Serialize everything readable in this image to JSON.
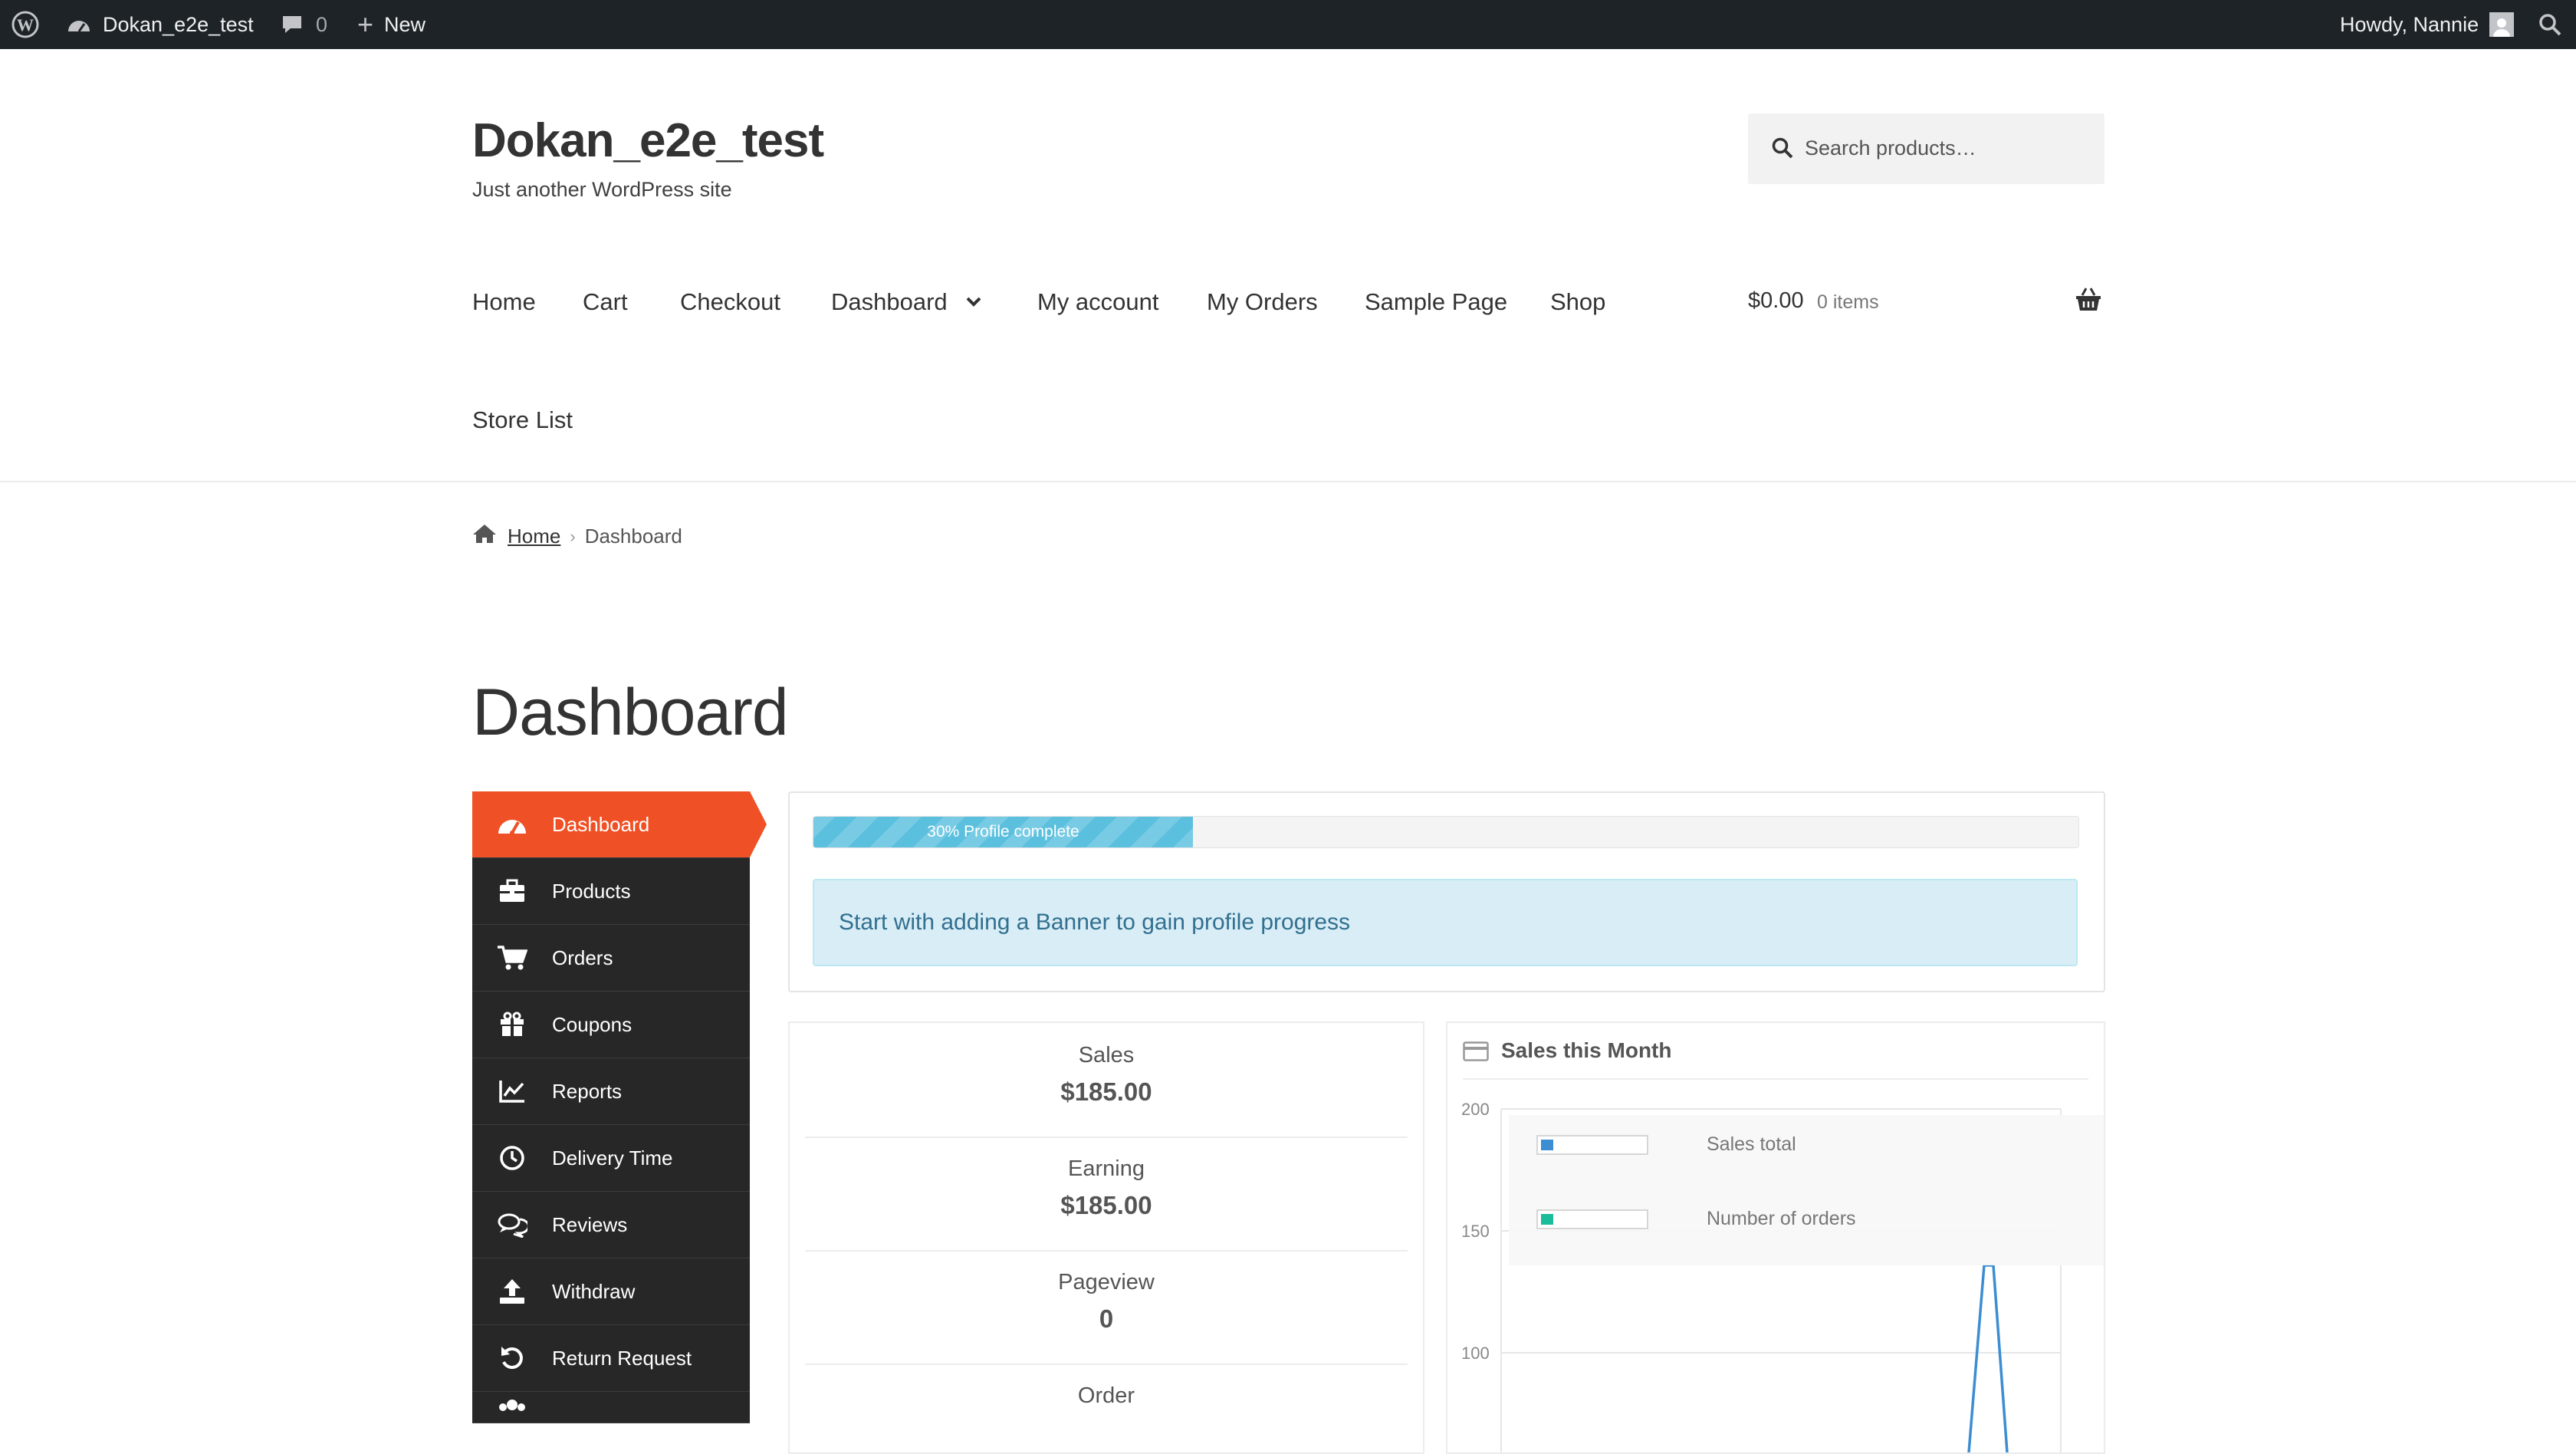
{
  "adminbar": {
    "site_name": "Dokan_e2e_test",
    "comments_count": "0",
    "new_label": "New",
    "greeting": "Howdy, Nannie"
  },
  "header": {
    "site_title": "Dokan_e2e_test",
    "tagline": "Just another WordPress site",
    "search_placeholder": "Search products…",
    "nav": [
      {
        "label": "Home"
      },
      {
        "label": "Cart"
      },
      {
        "label": "Checkout"
      },
      {
        "label": "Dashboard"
      },
      {
        "label": "My account"
      },
      {
        "label": "My Orders"
      },
      {
        "label": "Sample Page"
      },
      {
        "label": "Shop"
      },
      {
        "label": "Store List"
      }
    ],
    "cart_amount": "$0.00",
    "cart_items": "0 items"
  },
  "breadcrumb": {
    "home": "Home",
    "current": "Dashboard"
  },
  "page_title": "Dashboard",
  "sidebar": {
    "items": [
      {
        "label": "Dashboard",
        "icon": "tachometer-icon",
        "active": true
      },
      {
        "label": "Products",
        "icon": "briefcase-icon"
      },
      {
        "label": "Orders",
        "icon": "cart-icon"
      },
      {
        "label": "Coupons",
        "icon": "gift-icon"
      },
      {
        "label": "Reports",
        "icon": "line-chart-icon"
      },
      {
        "label": "Delivery Time",
        "icon": "clock-icon"
      },
      {
        "label": "Reviews",
        "icon": "comments-icon"
      },
      {
        "label": "Withdraw",
        "icon": "upload-icon"
      },
      {
        "label": "Return Request",
        "icon": "undo-icon"
      }
    ]
  },
  "profile": {
    "progress_percent": 30,
    "progress_label": "30% Profile complete",
    "notice": "Start with adding a Banner to gain profile progress"
  },
  "stats": [
    {
      "label": "Sales",
      "value": "$185.00"
    },
    {
      "label": "Earning",
      "value": "$185.00"
    },
    {
      "label": "Pageview",
      "value": "0"
    },
    {
      "label": "Order",
      "value": ""
    }
  ],
  "chart_data": {
    "type": "line",
    "title": "Sales this Month",
    "y_ticks": [
      "200",
      "150",
      "100"
    ],
    "ylim": [
      100,
      200
    ],
    "legend_placement": "top",
    "series": [
      {
        "name": "Sales total",
        "color": "#3c8dd1"
      },
      {
        "name": "Number of orders",
        "color": "#1abc9c"
      }
    ]
  },
  "colors": {
    "accent": "#f05025",
    "sidebar_bg": "#272727",
    "admin_bar": "#1d2327",
    "progress": "#5bc0de",
    "notice_bg": "#d9edf7",
    "notice_text": "#31708f"
  }
}
